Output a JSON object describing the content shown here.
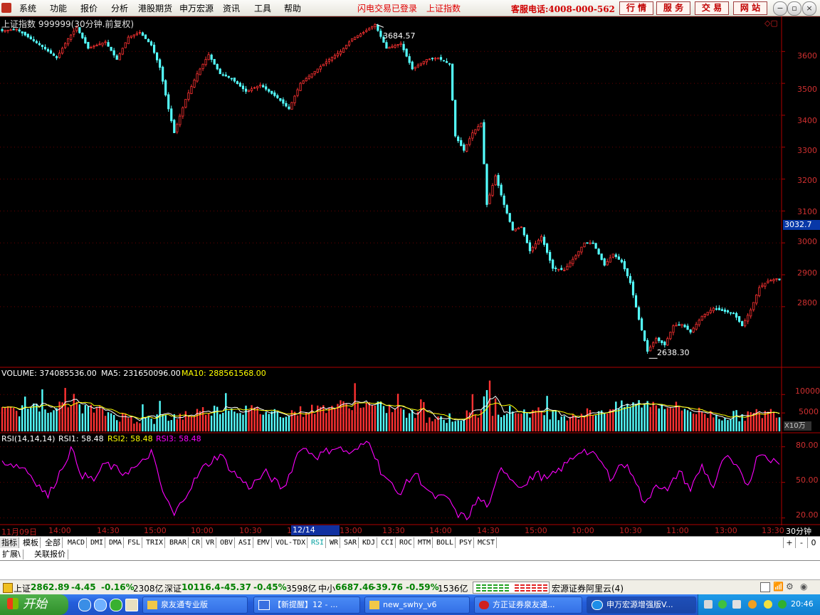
{
  "menu": {
    "items": [
      "系统",
      "功能",
      "报价",
      "分析",
      "港股期货",
      "申万宏源",
      "资讯",
      "工具",
      "帮助"
    ],
    "status": [
      "闪电交易已登录",
      "上证指数"
    ],
    "hotline": "客服电话:4008-000-562",
    "buttons": [
      "行 情",
      "服 务",
      "交 易",
      "网 站"
    ]
  },
  "chart_header": {
    "title": "上证指数 999999(30分钟.前复权)"
  },
  "chart_data": [
    {
      "type": "candlestick",
      "title": "上证指数 999999(30分钟.前复权)",
      "yticks": [
        3600,
        3500,
        3400,
        3300,
        3200,
        3100,
        3000,
        2900,
        2800
      ],
      "ylim": [
        2610,
        3710
      ],
      "current_price": "3032.7",
      "max_label": "3684.57",
      "min_label": "2638.30",
      "max_value": 3684.57,
      "min_value": 2638.3,
      "anchors": [
        [
          0,
          3665
        ],
        [
          5,
          3670
        ],
        [
          14,
          3615
        ],
        [
          19,
          3580
        ],
        [
          23,
          3640
        ],
        [
          26,
          3675
        ],
        [
          30,
          3610
        ],
        [
          36,
          3630
        ],
        [
          40,
          3575
        ],
        [
          44,
          3645
        ],
        [
          48,
          3660
        ],
        [
          52,
          3620
        ],
        [
          55,
          3550
        ],
        [
          58,
          3420
        ],
        [
          60,
          3345
        ],
        [
          64,
          3450
        ],
        [
          68,
          3530
        ],
        [
          72,
          3590
        ],
        [
          76,
          3530
        ],
        [
          80,
          3515
        ],
        [
          85,
          3475
        ],
        [
          90,
          3495
        ],
        [
          96,
          3455
        ],
        [
          100,
          3420
        ],
        [
          104,
          3500
        ],
        [
          110,
          3545
        ],
        [
          114,
          3575
        ],
        [
          118,
          3600
        ],
        [
          122,
          3640
        ],
        [
          126,
          3660
        ],
        [
          130,
          3684
        ],
        [
          134,
          3610
        ],
        [
          139,
          3625
        ],
        [
          143,
          3545
        ],
        [
          148,
          3575
        ],
        [
          152,
          3580
        ],
        [
          156,
          3560
        ],
        [
          158,
          3335
        ],
        [
          161,
          3290
        ],
        [
          164,
          3345
        ],
        [
          167,
          3375
        ],
        [
          169,
          3120
        ],
        [
          172,
          3210
        ],
        [
          175,
          3120
        ],
        [
          178,
          3040
        ],
        [
          181,
          3050
        ],
        [
          184,
          2975
        ],
        [
          188,
          3020
        ],
        [
          192,
          2920
        ],
        [
          196,
          2915
        ],
        [
          200,
          2960
        ],
        [
          203,
          3000
        ],
        [
          206,
          3000
        ],
        [
          210,
          2930
        ],
        [
          213,
          2965
        ],
        [
          216,
          2940
        ],
        [
          219,
          2875
        ],
        [
          222,
          2760
        ],
        [
          225,
          2660
        ],
        [
          228,
          2700
        ],
        [
          231,
          2680
        ],
        [
          234,
          2740
        ],
        [
          237,
          2745
        ],
        [
          240,
          2720
        ],
        [
          244,
          2770
        ],
        [
          248,
          2795
        ],
        [
          252,
          2785
        ],
        [
          255,
          2780
        ],
        [
          258,
          2740
        ],
        [
          261,
          2790
        ],
        [
          264,
          2860
        ],
        [
          267,
          2880
        ],
        [
          270,
          2888
        ],
        [
          272,
          2880
        ]
      ],
      "n_bars": 272
    },
    {
      "type": "bar",
      "title": "VOLUME",
      "legend": [
        {
          "name": "VOLUME",
          "value": "374085536.00",
          "color": "#ffffff"
        },
        {
          "name": "MA5",
          "value": "231650096.00",
          "color": "#ffffff"
        },
        {
          "name": "MA10",
          "value": "288561568.00",
          "color": "#ffff00"
        }
      ],
      "yticks": [
        10000,
        5000
      ],
      "unit": "X10万",
      "ylim": [
        0,
        14500
      ]
    },
    {
      "type": "line",
      "title": "RSI(14,14,14)",
      "legend": [
        {
          "name": "RSI1",
          "value": "58.48",
          "color": "#ffffff"
        },
        {
          "name": "RSI2",
          "value": "58.48",
          "color": "#ffff00"
        },
        {
          "name": "RSI3",
          "value": "58.48",
          "color": "#ff00ff"
        }
      ],
      "yticks": [
        "80.00",
        "50.00",
        "20.00"
      ],
      "ylim": [
        15,
        90
      ],
      "anchors": [
        [
          0,
          68
        ],
        [
          8,
          62
        ],
        [
          12,
          50
        ],
        [
          16,
          38
        ],
        [
          20,
          58
        ],
        [
          24,
          78
        ],
        [
          28,
          56
        ],
        [
          32,
          52
        ],
        [
          36,
          66
        ],
        [
          42,
          58
        ],
        [
          48,
          64
        ],
        [
          52,
          76
        ],
        [
          56,
          42
        ],
        [
          60,
          22
        ],
        [
          64,
          40
        ],
        [
          70,
          62
        ],
        [
          76,
          74
        ],
        [
          80,
          60
        ],
        [
          86,
          46
        ],
        [
          92,
          58
        ],
        [
          98,
          44
        ],
        [
          104,
          80
        ],
        [
          110,
          72
        ],
        [
          116,
          80
        ],
        [
          122,
          74
        ],
        [
          128,
          86
        ],
        [
          132,
          60
        ],
        [
          138,
          40
        ],
        [
          144,
          58
        ],
        [
          150,
          38
        ],
        [
          156,
          36
        ],
        [
          158,
          24
        ],
        [
          162,
          20
        ],
        [
          166,
          36
        ],
        [
          170,
          30
        ],
        [
          174,
          64
        ],
        [
          178,
          52
        ],
        [
          182,
          46
        ],
        [
          186,
          58
        ],
        [
          190,
          52
        ],
        [
          196,
          64
        ],
        [
          202,
          78
        ],
        [
          208,
          70
        ],
        [
          212,
          54
        ],
        [
          216,
          66
        ],
        [
          220,
          58
        ],
        [
          224,
          30
        ],
        [
          228,
          50
        ],
        [
          232,
          42
        ],
        [
          236,
          60
        ],
        [
          240,
          44
        ],
        [
          244,
          64
        ],
        [
          248,
          46
        ],
        [
          252,
          72
        ],
        [
          256,
          62
        ],
        [
          260,
          48
        ],
        [
          264,
          76
        ],
        [
          268,
          70
        ],
        [
          272,
          62
        ]
      ]
    }
  ],
  "time_axis": {
    "labels": [
      "11月09日",
      "14:00",
      "14:30",
      "15:00",
      "10:00",
      "10:30",
      "11",
      "13:00",
      "13:30",
      "14:00",
      "14:30",
      "15:00",
      "10:00",
      "10:30",
      "11:00",
      "13:00",
      "13:30"
    ],
    "highlight": "12/14 14:00",
    "period": "30分钟"
  },
  "tabs": {
    "items": [
      "指标",
      "模板",
      "全部",
      "MACD",
      "DMI",
      "DMA",
      "FSL",
      "TRIX",
      "BRAR",
      "CR",
      "VR",
      "OBV",
      "ASI",
      "EMV",
      "VOL-TDX",
      "RSI",
      "WR",
      "SAR",
      "KDJ",
      "CCI",
      "ROC",
      "MTM",
      "BOLL",
      "PSY",
      "MCST"
    ],
    "selected": "RSI",
    "zoom": [
      "+",
      "-",
      "0"
    ]
  },
  "subtabs": [
    "扩展\\",
    "关联报价"
  ],
  "ticker": {
    "items": [
      {
        "name": "上证",
        "price": "2862.89",
        "change": "-4.45",
        "pct": "-0.16%",
        "amount": "2308亿"
      },
      {
        "name": "深证",
        "price": "10116.4",
        "change": "-45.37",
        "pct": "-0.45%",
        "amount": "3598亿"
      },
      {
        "name": "中小",
        "price": "6687.46",
        "change": "-39.76",
        "pct": "-0.59%",
        "amount": "1536亿"
      }
    ],
    "broker": "宏源证券阿里云(4)"
  },
  "taskbar": {
    "start": "开始",
    "tasks": [
      "泉友通专业版",
      "【新提醒】12 - ...",
      "new_swhy_v6",
      "方正证券泉友通...",
      "申万宏源增强版V..."
    ],
    "clock": "20:46"
  },
  "colors": {
    "up": "#ff3232",
    "down": "#54ffff",
    "rsi": "#ff00ff",
    "axis": "#b00000"
  }
}
